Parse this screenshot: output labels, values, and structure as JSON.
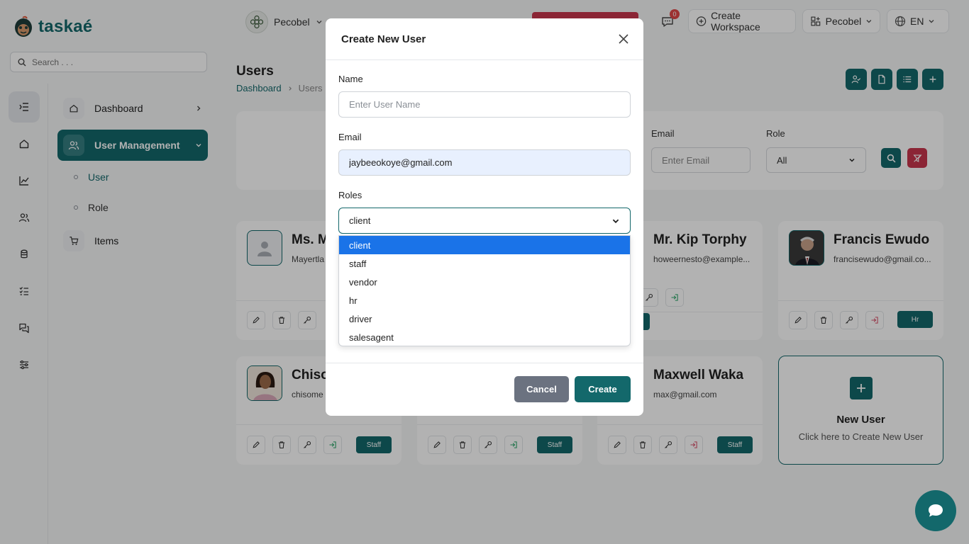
{
  "app": {
    "name": "taskaé"
  },
  "search": {
    "placeholder": "Search . . ."
  },
  "topbar": {
    "workspace": "Pecobel",
    "notifications_count": "0",
    "create_workspace": "Create Workspace",
    "org": "Pecobel",
    "language": "EN"
  },
  "sidebar": {
    "items": [
      {
        "label": "Dashboard"
      },
      {
        "label": "User Management"
      },
      {
        "label": "Items"
      }
    ],
    "sub_items": [
      {
        "label": "User"
      },
      {
        "label": "Role"
      }
    ]
  },
  "page": {
    "title": "Users",
    "breadcrumb": [
      "Dashboard",
      "Users"
    ]
  },
  "filters": {
    "email_label": "Email",
    "email_placeholder": "Enter Email",
    "role_label": "Role",
    "role_value": "All"
  },
  "users": [
    {
      "name": "Ms. M",
      "email": "Mayertla",
      "role": ""
    },
    {
      "name": "Mr. Kip Torphy",
      "email": "howeernesto@example...",
      "role": ""
    },
    {
      "name": "Francis Ewudo",
      "email": "francisewudo@gmail.co...",
      "role": "Hr"
    },
    {
      "name": "Chiso",
      "email": "chisome",
      "role": "Staff"
    },
    {
      "name": "",
      "email": "",
      "role": "Staff"
    },
    {
      "name": "Maxwell Waka",
      "email": "max@gmail.com",
      "role": "Staff"
    }
  ],
  "new_user_card": {
    "title": "New User",
    "subtitle": "Click here to Create New User"
  },
  "modal": {
    "title": "Create New User",
    "name_label": "Name",
    "name_placeholder": "Enter User Name",
    "email_label": "Email",
    "email_value": "jaybeeokoye@gmail.com",
    "roles_label": "Roles",
    "roles_selected": "client",
    "role_options": [
      "client",
      "staff",
      "vendor",
      "hr",
      "driver",
      "salesagent"
    ],
    "cancel_label": "Cancel",
    "create_label": "Create"
  },
  "colors": {
    "primary": "#13686b",
    "danger": "#c8364c",
    "selected_option": "#1a73e8",
    "cancel": "#6b7280"
  }
}
